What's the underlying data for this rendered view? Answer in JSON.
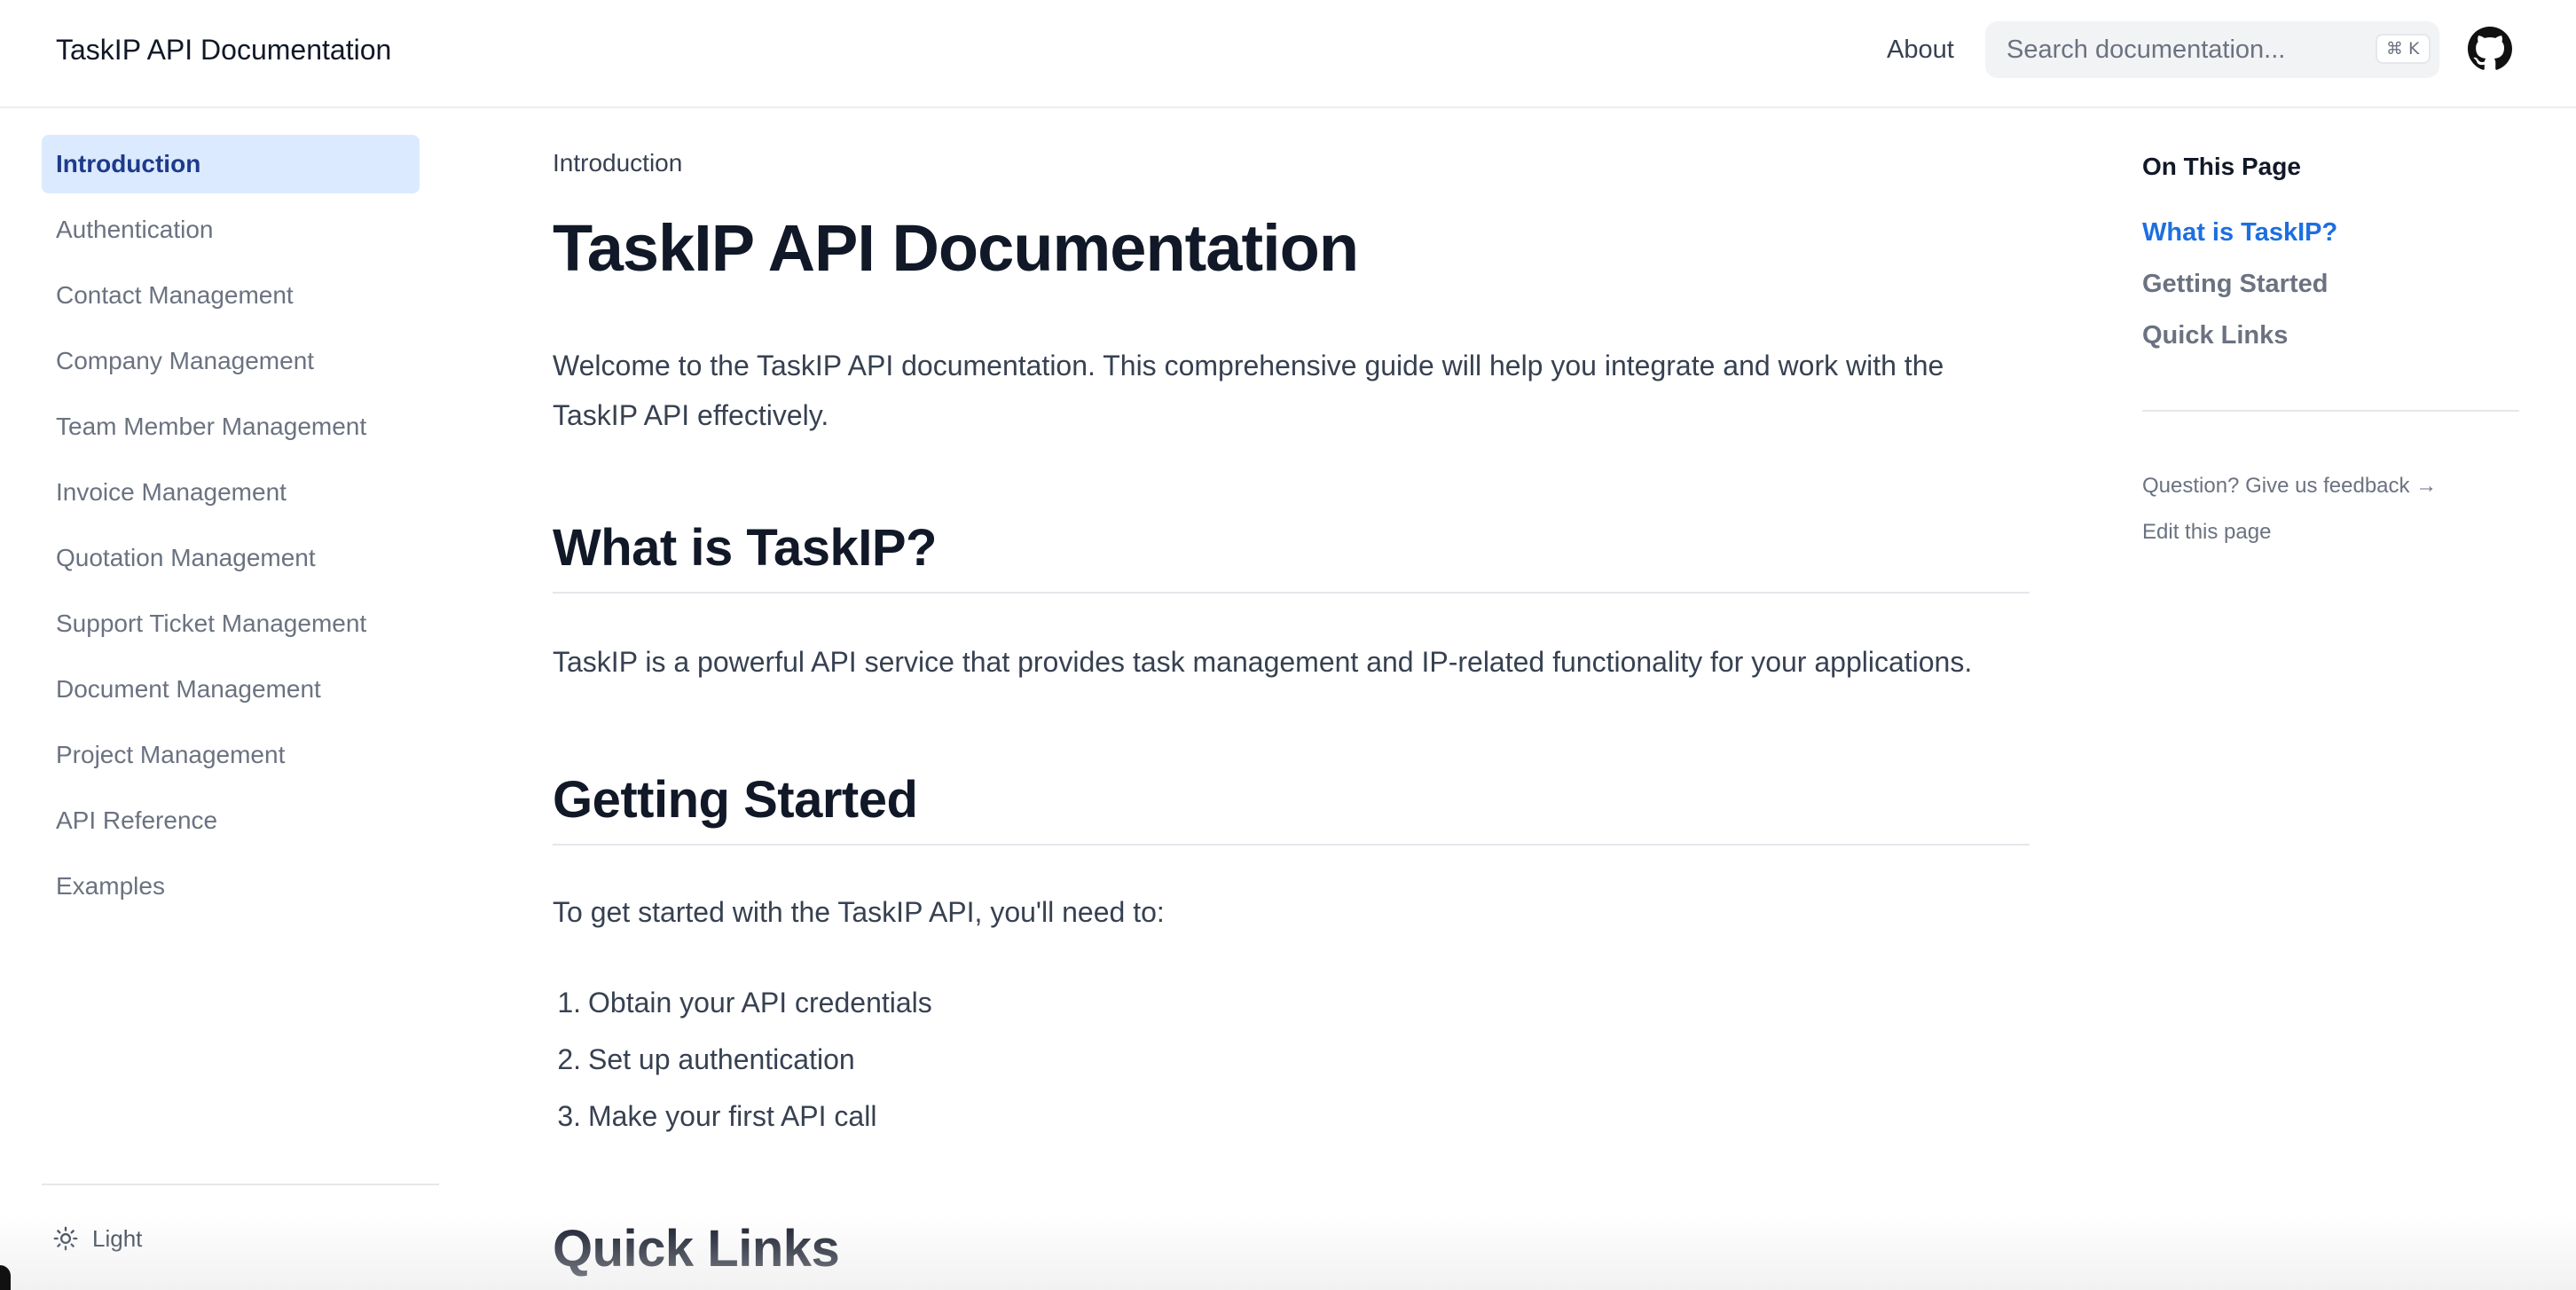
{
  "header": {
    "site_title": "TaskIP API Documentation",
    "about_label": "About",
    "search_placeholder": "Search documentation...",
    "search_shortcut": "⌘ K",
    "github_icon": "github-icon"
  },
  "sidebar": {
    "items": [
      {
        "label": "Introduction",
        "active": true
      },
      {
        "label": "Authentication"
      },
      {
        "label": "Contact Management"
      },
      {
        "label": "Company Management"
      },
      {
        "label": "Team Member Management"
      },
      {
        "label": "Invoice Management"
      },
      {
        "label": "Quotation Management"
      },
      {
        "label": "Support Ticket Management"
      },
      {
        "label": "Document Management"
      },
      {
        "label": "Project Management"
      },
      {
        "label": "API Reference"
      },
      {
        "label": "Examples"
      }
    ],
    "theme_label": "Light",
    "theme_icon": "sun-icon"
  },
  "main": {
    "breadcrumb": "Introduction",
    "title": "TaskIP API Documentation",
    "intro": "Welcome to the TaskIP API documentation. This comprehensive guide will help you integrate and work with the TaskIP API effectively.",
    "sections": [
      {
        "heading": "What is TaskIP?",
        "text": "TaskIP is a powerful API service that provides task management and IP-related functionality for your applications."
      },
      {
        "heading": "Getting Started",
        "text": "To get started with the TaskIP API, you'll need to:",
        "steps": [
          {
            "num": "1.",
            "text": "Obtain your API credentials"
          },
          {
            "num": "2.",
            "text": "Set up authentication"
          },
          {
            "num": "3.",
            "text": "Make your first API call"
          }
        ]
      },
      {
        "heading": "Quick Links"
      }
    ]
  },
  "toc": {
    "title": "On This Page",
    "links": [
      {
        "label": "What is TaskIP?",
        "active": true
      },
      {
        "label": "Getting Started"
      },
      {
        "label": "Quick Links"
      }
    ],
    "feedback_label": "Question? Give us feedback →",
    "edit_label": "Edit this page"
  },
  "colors": {
    "accent": "#1d6fe0",
    "active_nav_bg": "#dbeafe",
    "active_nav_text": "#1e3a8a"
  }
}
